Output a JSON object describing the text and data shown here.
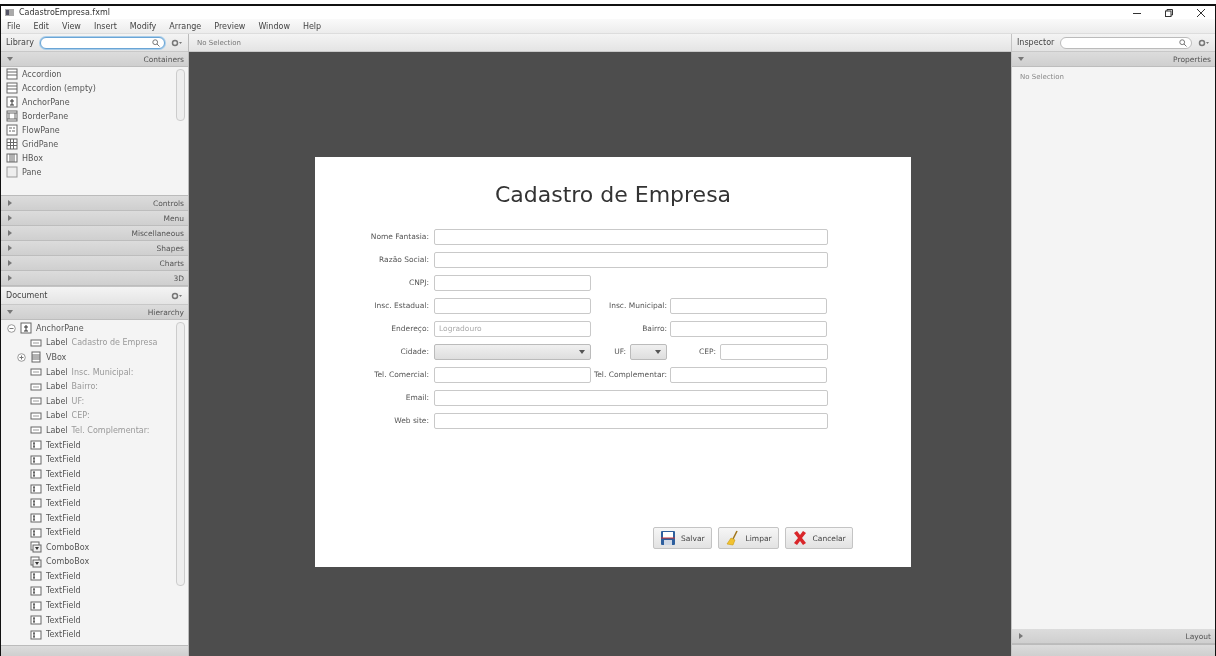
{
  "window": {
    "title": "CadastroEmpresa.fxml"
  },
  "menu": [
    "File",
    "Edit",
    "View",
    "Insert",
    "Modify",
    "Arrange",
    "Preview",
    "Window",
    "Help"
  ],
  "library": {
    "title": "Library",
    "sections": [
      {
        "label": "Containers",
        "expanded": true,
        "items": [
          {
            "label": "Accordion",
            "kind": "accordion"
          },
          {
            "label": "Accordion  (empty)",
            "kind": "accordion"
          },
          {
            "label": "AnchorPane",
            "kind": "anchor"
          },
          {
            "label": "BorderPane",
            "kind": "border"
          },
          {
            "label": "FlowPane",
            "kind": "flow"
          },
          {
            "label": "GridPane",
            "kind": "grid"
          },
          {
            "label": "HBox",
            "kind": "hbox"
          },
          {
            "label": "Pane",
            "kind": "pane"
          }
        ]
      },
      {
        "label": "Controls",
        "expanded": false
      },
      {
        "label": "Menu",
        "expanded": false
      },
      {
        "label": "Miscellaneous",
        "expanded": false
      },
      {
        "label": "Shapes",
        "expanded": false
      },
      {
        "label": "Charts",
        "expanded": false
      },
      {
        "label": "3D",
        "expanded": false
      }
    ]
  },
  "document": {
    "title": "Document",
    "section": {
      "label": "Hierarchy",
      "expanded": true
    },
    "tree": [
      {
        "type": "AnchorPane",
        "kind": "anchor",
        "expanded": true,
        "children": [
          {
            "type": "Label",
            "name": "Cadastro de Empresa",
            "kind": "label"
          },
          {
            "type": "VBox",
            "kind": "vbox",
            "expanded": false
          },
          {
            "type": "Label",
            "name": "Insc. Municipal:",
            "kind": "label"
          },
          {
            "type": "Label",
            "name": "Bairro:",
            "kind": "label"
          },
          {
            "type": "Label",
            "name": "UF:",
            "kind": "label"
          },
          {
            "type": "Label",
            "name": "CEP:",
            "kind": "label"
          },
          {
            "type": "Label",
            "name": "Tel. Complementar:",
            "kind": "label"
          },
          {
            "type": "TextField",
            "kind": "textfield"
          },
          {
            "type": "TextField",
            "kind": "textfield"
          },
          {
            "type": "TextField",
            "kind": "textfield"
          },
          {
            "type": "TextField",
            "kind": "textfield"
          },
          {
            "type": "TextField",
            "kind": "textfield"
          },
          {
            "type": "TextField",
            "kind": "textfield"
          },
          {
            "type": "TextField",
            "kind": "textfield"
          },
          {
            "type": "ComboBox",
            "kind": "combo"
          },
          {
            "type": "ComboBox",
            "kind": "combo"
          },
          {
            "type": "TextField",
            "kind": "textfield"
          },
          {
            "type": "TextField",
            "kind": "textfield"
          },
          {
            "type": "TextField",
            "kind": "textfield"
          },
          {
            "type": "TextField",
            "kind": "textfield"
          },
          {
            "type": "TextField",
            "kind": "textfield"
          }
        ]
      }
    ]
  },
  "canvas": {
    "selection": "No Selection"
  },
  "form": {
    "title": "Cadastro de Empresa",
    "rows": [
      {
        "fields": [
          {
            "label": "Nome Fantasia:",
            "kind": "text"
          }
        ]
      },
      {
        "fields": [
          {
            "label": "Razão Social:",
            "kind": "text"
          }
        ]
      },
      {
        "fields": [
          {
            "label": "CNPJ:",
            "kind": "text"
          }
        ]
      },
      {
        "fields": [
          {
            "label": "Insc. Estadual:",
            "kind": "text"
          },
          {
            "label": "Insc. Municipal:",
            "kind": "text"
          }
        ]
      },
      {
        "fields": [
          {
            "label": "Endereço:",
            "kind": "text",
            "placeholder": "Logradouro"
          },
          {
            "label": "Bairro:",
            "kind": "text"
          }
        ]
      },
      {
        "fields": [
          {
            "label": "Cidade:",
            "kind": "combo"
          },
          {
            "label": "UF:",
            "kind": "combo"
          },
          {
            "label": "CEP:",
            "kind": "text"
          }
        ]
      },
      {
        "fields": [
          {
            "label": "Tel. Comercial:",
            "kind": "text"
          },
          {
            "label": "Tel. Complementar:",
            "kind": "text"
          }
        ]
      },
      {
        "fields": [
          {
            "label": "Email:",
            "kind": "text"
          }
        ]
      },
      {
        "fields": [
          {
            "label": "Web site:",
            "kind": "text"
          }
        ]
      }
    ],
    "buttons": [
      {
        "label": "Salvar",
        "kind": "save"
      },
      {
        "label": "Limpar",
        "kind": "clear"
      },
      {
        "label": "Cancelar",
        "kind": "cancel"
      }
    ]
  },
  "inspector": {
    "title": "Inspector",
    "section": {
      "label": "Properties",
      "expanded": true
    },
    "message": "No Selection",
    "bottom_sections": [
      {
        "label": "Layout",
        "expanded": false
      }
    ]
  }
}
